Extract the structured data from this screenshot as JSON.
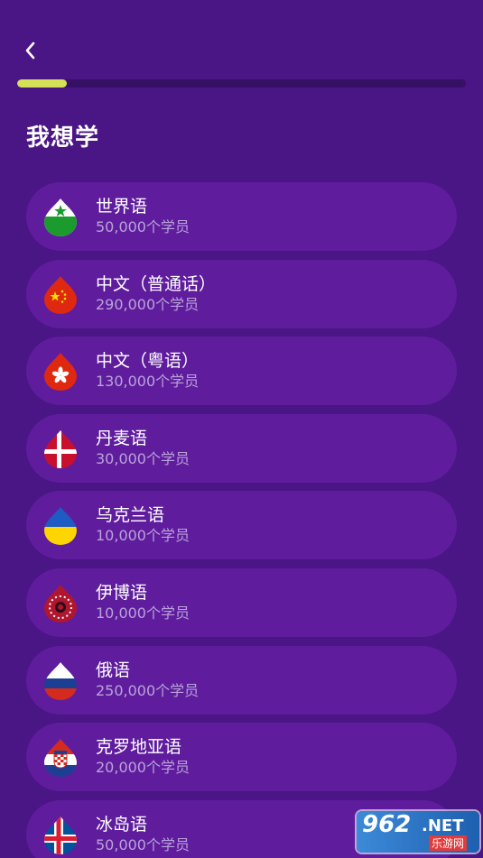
{
  "progress": 0.11,
  "title": "我想学",
  "languages": [
    {
      "name": "世界语",
      "count": "50,000个学员",
      "flag": "esperanto-flag-icon"
    },
    {
      "name": "中文（普通话）",
      "count": "290,000个学员",
      "flag": "china-flag-icon"
    },
    {
      "name": "中文（粤语）",
      "count": "130,000个学员",
      "flag": "hong-kong-flag-icon"
    },
    {
      "name": "丹麦语",
      "count": "30,000个学员",
      "flag": "denmark-flag-icon"
    },
    {
      "name": "乌克兰语",
      "count": "10,000个学员",
      "flag": "ukraine-flag-icon"
    },
    {
      "name": "伊博语",
      "count": "10,000个学员",
      "flag": "igbo-flag-icon"
    },
    {
      "name": "俄语",
      "count": "250,000个学员",
      "flag": "russia-flag-icon"
    },
    {
      "name": "克罗地亚语",
      "count": "20,000个学员",
      "flag": "croatia-flag-icon"
    },
    {
      "name": "冰岛语",
      "count": "50,000个学员",
      "flag": "iceland-flag-icon"
    }
  ],
  "watermark": {
    "number": "962",
    "tld": ".NET",
    "name": "乐游网"
  },
  "colors": {
    "background": "#4a1584",
    "card": "#5f1d9e",
    "progress_fill": "#d4e157",
    "subtext": "#b9a3d9"
  }
}
